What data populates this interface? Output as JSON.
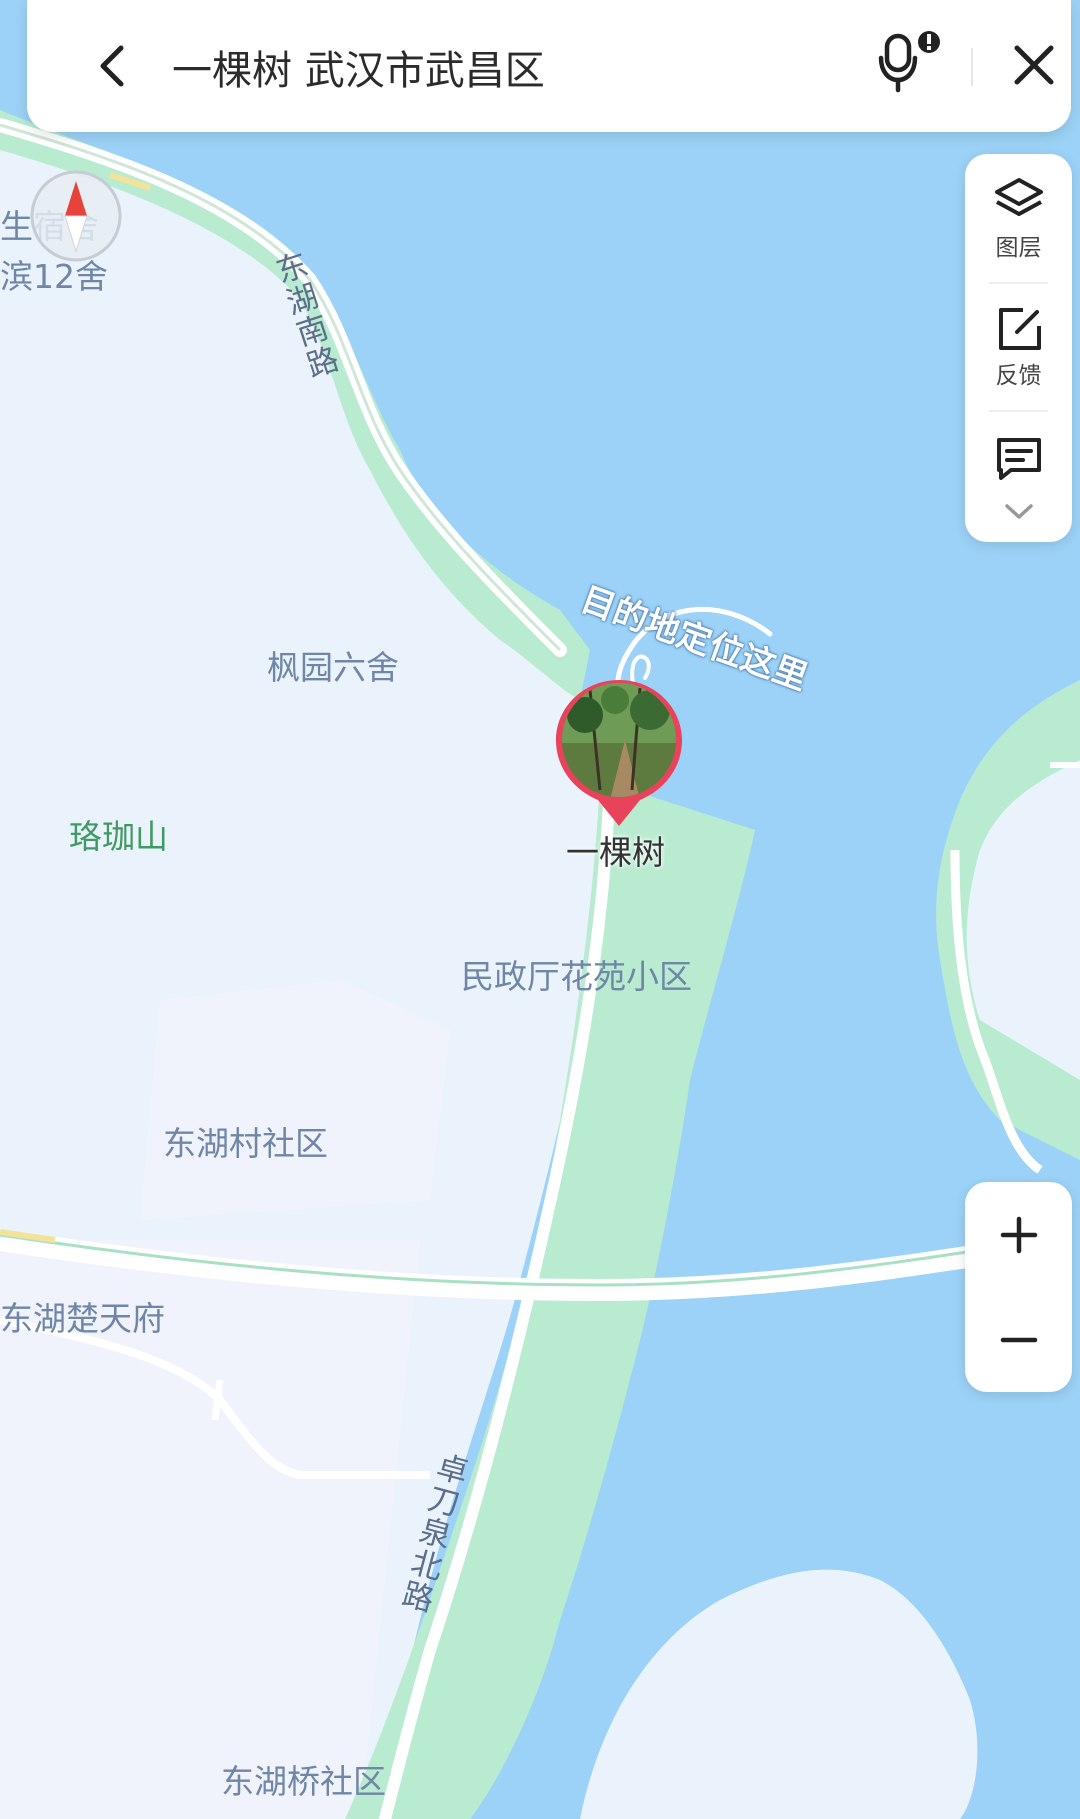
{
  "search": {
    "query": "一棵树 武汉市武昌区",
    "back_icon": "back-arrow-icon",
    "mic_icon": "microphone-icon",
    "close_icon": "close-icon"
  },
  "tools": [
    {
      "label": "图层",
      "icon": "layers-icon"
    },
    {
      "label": "反馈",
      "icon": "feedback-edit-icon"
    },
    {
      "label": "",
      "icon": "message-icon"
    }
  ],
  "zoom": {
    "in_icon": "plus-icon",
    "out_icon": "minus-icon"
  },
  "map": {
    "colors": {
      "water": "#9cd2f7",
      "land": "#eaf3fb",
      "park": "#b9ebd1",
      "road": "#ffffff"
    },
    "poi": {
      "dorm1": "生宿舍",
      "dorm2": "滨12舍",
      "fengyuan": "枫园六舍",
      "luojiashan": "珞珈山",
      "minzheng": "民政厅花苑小区",
      "donghucun": "东湖村社区",
      "chutianfu": "东湖楚天府",
      "donghuqiao": "东湖桥社区"
    },
    "roads": {
      "donghu_south": "东湖南路",
      "zhuodaoquan": "卓刀泉北路"
    },
    "destination": {
      "name": "一棵树",
      "annotation": "目的地定位这里"
    }
  }
}
